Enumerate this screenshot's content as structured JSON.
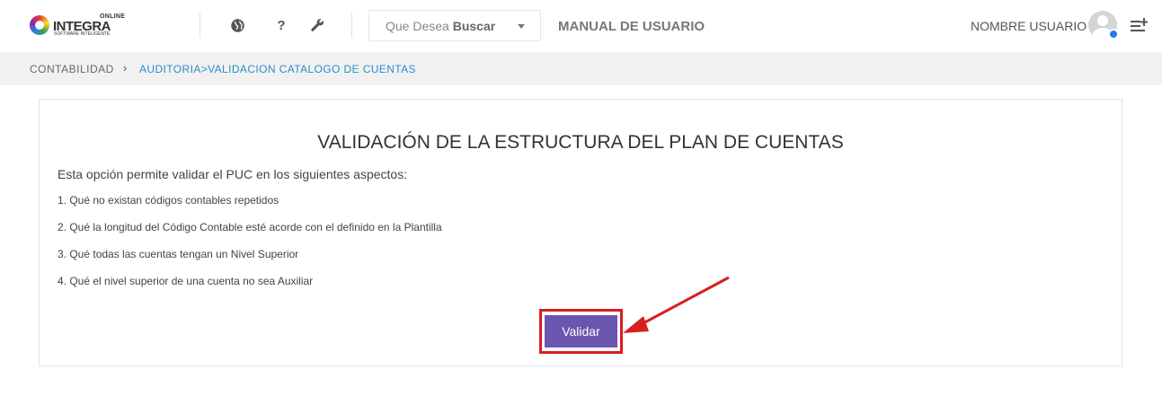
{
  "header": {
    "logo": {
      "small": "ONLINE",
      "name": "INTEGRA",
      "tagline": "SOFTWARE INTELIGENTE"
    },
    "icons": [
      "globe-icon",
      "help-icon",
      "wrench-icon"
    ],
    "search": {
      "label": "Que Desea",
      "bold": "Buscar"
    },
    "manual_label": "MANUAL DE USUARIO",
    "user_name": "NOMBRE USUARIO"
  },
  "breadcrumb": {
    "root": "CONTABILIDAD",
    "separator": "›",
    "current": "AUDITORIA>VALIDACION CATALOGO DE CUENTAS"
  },
  "main": {
    "title": "VALIDACIÓN DE LA ESTRUCTURA DEL PLAN DE CUENTAS",
    "intro": "Esta opción permite validar el PUC en los siguientes aspectos:",
    "items": [
      "1. Qué no existan códigos contables repetidos",
      "2. Qué la longitud del Código Contable esté acorde con el definido en la Plantilla",
      "3. Qué todas las cuentas tengan un Nivel Superior",
      "4. Qué el nivel superior de una cuenta no sea Auxiliar"
    ],
    "button_label": "Validar"
  },
  "colors": {
    "accent_button": "#6a55b0",
    "highlight": "#d81e1e",
    "breadcrumb_link": "#2a8fc7",
    "status_dot": "#1e7fe0"
  }
}
